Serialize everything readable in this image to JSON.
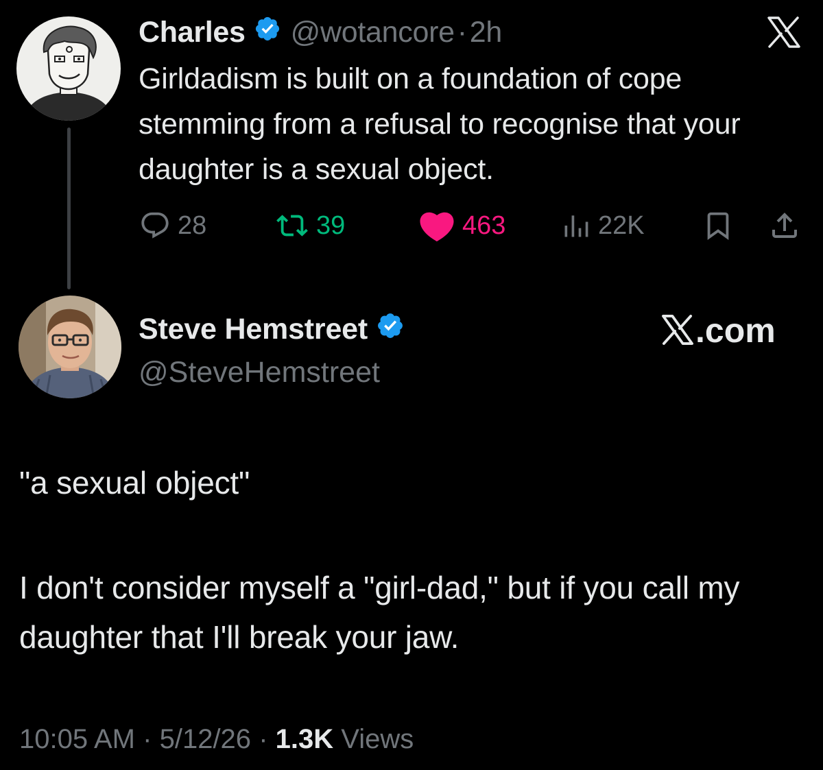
{
  "quoted_tweet": {
    "author_name": "Charles",
    "handle": "@wotancore",
    "separator": "·",
    "time": "2h",
    "text": "Girldadism is built on a foundation of cope stemming from a refusal to recognise that your daughter is a sexual object.",
    "stats": {
      "replies": "28",
      "retweets": "39",
      "likes": "463",
      "views": "22K"
    }
  },
  "main_tweet": {
    "author_name": "Steve Hemstreet",
    "handle": "@SteveHemstreet",
    "watermark": ".com",
    "text_line_1": "\"a sexual object\"",
    "text_para_2": "I don't consider myself a \"girl-dad,\" but if you call my daughter that I'll break your jaw.",
    "footer": {
      "time": "10:05 AM",
      "sep1": "·",
      "date": "5/12/26",
      "sep2": "·",
      "views_count": "1.3K",
      "views_label": "Views"
    }
  },
  "icons": {
    "verified": "verified-badge-icon",
    "x_logo": "x-logo-icon",
    "reply": "reply-icon",
    "retweet": "retweet-icon",
    "like": "heart-icon",
    "views": "views-chart-icon",
    "bookmark": "bookmark-icon",
    "share": "share-icon"
  },
  "colors": {
    "background": "#000000",
    "text": "#e7e9ea",
    "secondary": "#71767b",
    "verified": "#1d9bf0",
    "retweet": "#00ba7c",
    "like": "#f91880"
  }
}
